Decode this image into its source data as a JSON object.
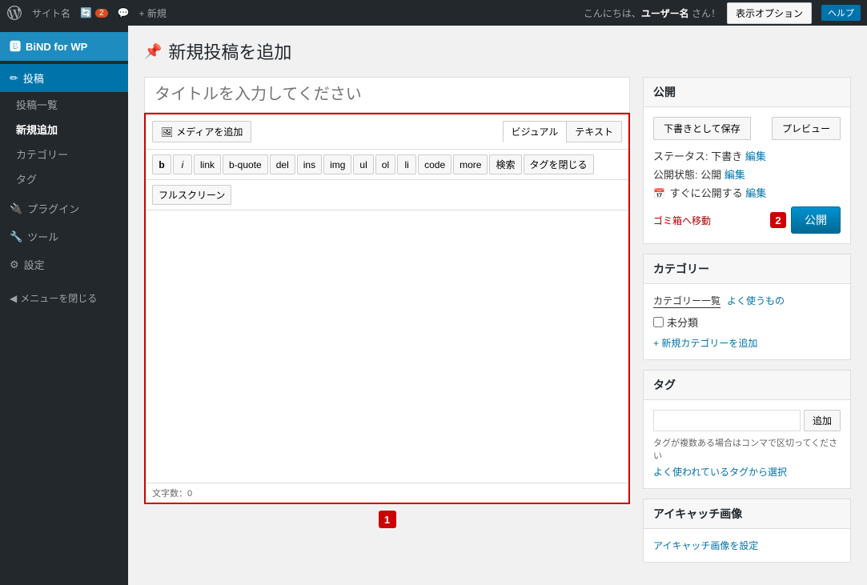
{
  "adminBar": {
    "siteName": "サイト名",
    "updateCount": "2",
    "commentIcon": "💬",
    "newLabel": "+ 新規",
    "greeting": "こんにちは、",
    "username": "ユーザー名",
    "greetingSuffix": " さん！",
    "displayOptions": "表示オプション",
    "help": "ヘルプ"
  },
  "sidebar": {
    "bindLogo": "BiND for WP",
    "posts": {
      "label": "投稿",
      "items": [
        {
          "label": "投稿一覧",
          "active": false
        },
        {
          "label": "新規追加",
          "active": true
        },
        {
          "label": "カテゴリー",
          "active": false
        },
        {
          "label": "タグ",
          "active": false
        }
      ]
    },
    "plugins": {
      "label": "プラグイン"
    },
    "tools": {
      "label": "ツール"
    },
    "settings": {
      "label": "設定"
    },
    "closeMenu": "メニューを閉じる"
  },
  "page": {
    "title": "新規投稿を追加",
    "titlePlaceholder": "タイトルを入力してください"
  },
  "editor": {
    "mediaButton": "メディアを追加",
    "visualTab": "ビジュアル",
    "textTab": "テキスト",
    "buttons": [
      "b",
      "i",
      "link",
      "b-quote",
      "del",
      "ins",
      "img",
      "ul",
      "ol",
      "li",
      "code",
      "more",
      "検索",
      "タグを閉じる"
    ],
    "fullscreenBtn": "フルスクリーン",
    "wordCount": "文字数：",
    "wordCountValue": "0"
  },
  "publish": {
    "title": "公開",
    "saveDraft": "下書きとして保存",
    "preview": "プレビュー",
    "statusLabel": "ステータス: ",
    "statusValue": "下書き",
    "statusEdit": "編集",
    "visibilityLabel": "公開状態: ",
    "visibilityValue": "公開",
    "visibilityEdit": "編集",
    "publishTimeLabel": "すぐに公開する",
    "publishTimeEdit": "編集",
    "trashLink": "ゴミ箱へ移動",
    "publishBtn": "公開",
    "step2": "2"
  },
  "category": {
    "title": "カテゴリー",
    "allTab": "カテゴリー一覧",
    "frequentTab": "よく使うもの",
    "uncategorized": "未分類",
    "addNew": "+ 新規カテゴリーを追加"
  },
  "tags": {
    "title": "タグ",
    "inputPlaceholder": "",
    "addBtn": "追加",
    "hint": "タグが複数ある場合はコンマで区切ってください",
    "selectLink": "よく使われているタグから選択"
  },
  "eyecatch": {
    "title": "アイキャッチ画像",
    "setLink": "アイキャッチ画像を設定"
  },
  "steps": {
    "step1": "1",
    "step2": "2"
  }
}
